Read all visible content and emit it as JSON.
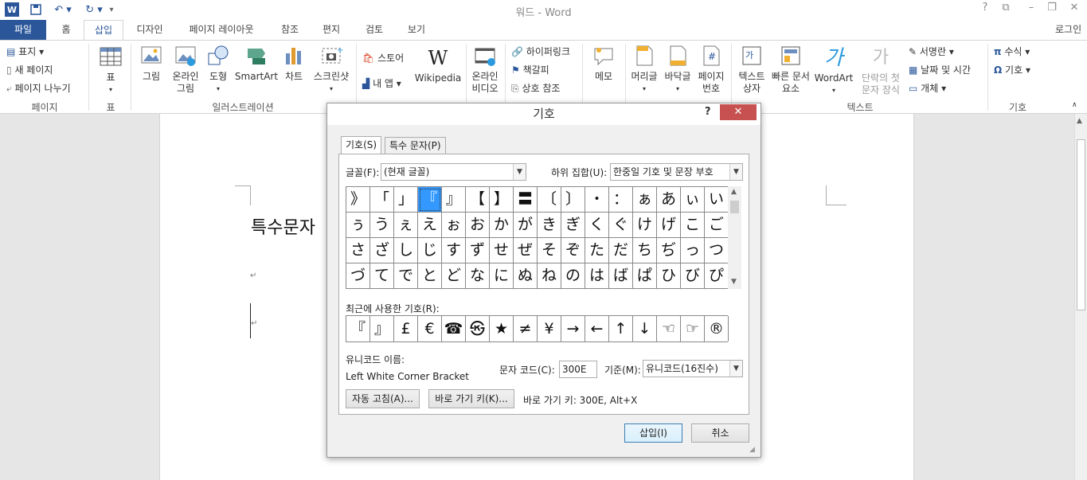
{
  "window": {
    "title": "워드 - Word",
    "login": "로그인"
  },
  "quick_access": {
    "undo_icon": "undo-icon",
    "redo_icon": "redo-icon",
    "save_icon": "save-icon"
  },
  "tabs": [
    "파일",
    "홈",
    "삽입",
    "디자인",
    "페이지 레이아웃",
    "참조",
    "편지",
    "검토",
    "보기"
  ],
  "ribbon": {
    "pages": {
      "cover": "표지",
      "blank": "새 페이지",
      "break": "페이지 나누기",
      "group": "페이지"
    },
    "table": {
      "label": "표",
      "group": "표"
    },
    "illustrations": {
      "picture": "그림",
      "online1": "온라인",
      "online2": "그림",
      "shapes": "도형",
      "smartart": "SmartArt",
      "chart": "차트",
      "screenshot": "스크린샷",
      "group": "일러스트레이션"
    },
    "apps": {
      "store": "스토어",
      "myapps": "내 앱",
      "wikipedia": "Wikipedia"
    },
    "media": {
      "video1": "온라인",
      "video2": "비디오"
    },
    "links": {
      "hyperlink": "하이퍼링크",
      "bookmark": "책갈피",
      "crossref": "상호 참조"
    },
    "comments": {
      "memo": "메모"
    },
    "header_footer": {
      "header": "머리글",
      "footer": "바닥글",
      "pagenum1": "페이지",
      "pagenum2": "번호"
    },
    "text": {
      "textbox1": "텍스트",
      "textbox2": "상자",
      "quick1": "빠른 문서",
      "quick2": "요소",
      "wordart": "WordArt",
      "dropcap1": "단락의 첫",
      "dropcap2": "문자 장식",
      "signature": "서명란",
      "datetime": "날짜 및 시간",
      "object": "개체",
      "group": "텍스트"
    },
    "symbols": {
      "equation": "수식",
      "symbol": "기호",
      "group": "기호"
    }
  },
  "document": {
    "text": "특수문자"
  },
  "dialog": {
    "title": "기호",
    "help": "?",
    "close": "✕",
    "tab_symbols": "기호(S)",
    "tab_special": "특수 문자(P)",
    "font_label": "글꼴(F):",
    "font_value": "(현재 글꼴)",
    "subset_label": "하위 집합(U):",
    "subset_value": "한중일 기호 및 문장 부호",
    "symbol_grid": [
      [
        "》",
        "「",
        "」",
        "『",
        "』",
        "【",
        "】",
        "〓",
        "〔",
        "〕",
        "・",
        "：",
        "ぁ",
        "あ",
        "ぃ",
        "い"
      ],
      [
        "ぅ",
        "う",
        "ぇ",
        "え",
        "ぉ",
        "お",
        "か",
        "が",
        "き",
        "ぎ",
        "く",
        "ぐ",
        "け",
        "げ",
        "こ",
        "ご"
      ],
      [
        "さ",
        "ざ",
        "し",
        "じ",
        "す",
        "ず",
        "せ",
        "ぜ",
        "そ",
        "ぞ",
        "た",
        "だ",
        "ち",
        "ぢ",
        "っ",
        "つ"
      ],
      [
        "づ",
        "て",
        "で",
        "と",
        "ど",
        "な",
        "に",
        "ぬ",
        "ね",
        "の",
        "は",
        "ば",
        "ぱ",
        "ひ",
        "び",
        "ぴ"
      ]
    ],
    "recent_label": "최근에 사용한 기호(R):",
    "recent": [
      "『",
      "』",
      "£",
      "€",
      "☎",
      "㉿",
      "★",
      "≠",
      "¥",
      "→",
      "←",
      "↑",
      "↓",
      "☜",
      "☞",
      "®"
    ],
    "unicode_name_label": "유니코드 이름:",
    "unicode_name": "Left White Corner Bracket",
    "charcode_label": "문자 코드(C):",
    "charcode_value": "300E",
    "from_label": "기준(M):",
    "from_value": "유니코드(16진수)",
    "autocorrect_button": "자동 고침(A)...",
    "shortcut_button": "바로 가기 키(K)...",
    "shortcut_text": "바로 가기 키: 300E, Alt+X",
    "insert_button": "삽입(I)",
    "cancel_button": "취소"
  }
}
